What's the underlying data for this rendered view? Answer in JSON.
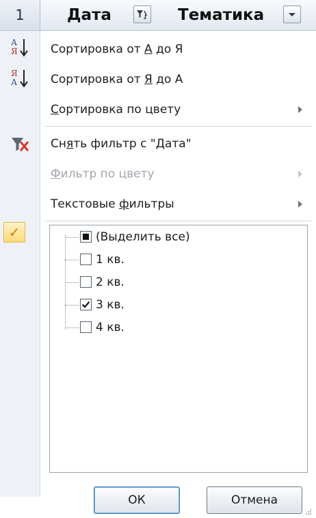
{
  "header": {
    "row_number": "1",
    "col_date": "Дата",
    "col_theme": "Тематика",
    "date_filter_icon": "filter-active-icon",
    "theme_dropdown_icon": "dropdown-arrow-icon"
  },
  "menu": {
    "sort_asc": {
      "pre": "Сортировка от ",
      "ul": "А",
      "post": " до Я",
      "icon": "sort-a-z-icon"
    },
    "sort_desc": {
      "pre": "Сортировка от ",
      "ul": "Я",
      "post": " до А",
      "icon": "sort-z-a-icon"
    },
    "sort_color": {
      "ul": "С",
      "post": "ортировка по цвету"
    },
    "clear_filter": {
      "pre": "Сн",
      "ul": "я",
      "post": "ть фильтр с \"Дата\"",
      "icon": "clear-filter-icon"
    },
    "filter_color": {
      "ul": "Ф",
      "post": "ильтр по цвету"
    },
    "text_filters": {
      "pre": "Текстовые ",
      "ul": "ф",
      "post": "ильтры"
    }
  },
  "list": {
    "select_all": "(Выделить все)",
    "items": [
      {
        "label": "1 кв.",
        "checked": false
      },
      {
        "label": "2 кв.",
        "checked": false
      },
      {
        "label": "3 кв.",
        "checked": true
      },
      {
        "label": "4 кв.",
        "checked": false
      }
    ]
  },
  "buttons": {
    "ok": "ОК",
    "cancel": "Отмена"
  },
  "colors": {
    "accent": "#3d7bb8",
    "clear_filter_red": "#d6392b",
    "check_gold": "#c77b00",
    "disabled_text": "#a3a7ad"
  }
}
